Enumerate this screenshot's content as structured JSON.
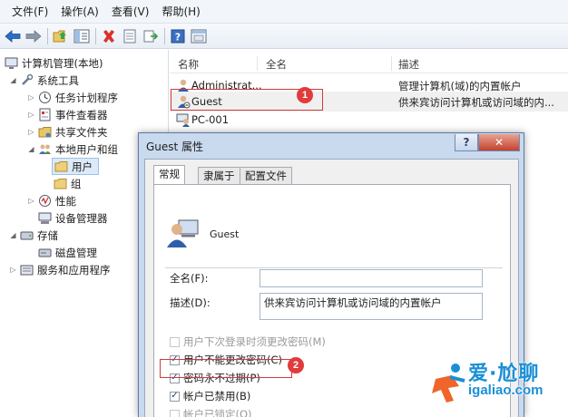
{
  "menu": [
    "文件(F)",
    "操作(A)",
    "查看(V)",
    "帮助(H)"
  ],
  "tree": {
    "root": "计算机管理(本地)",
    "system_tools": "系统工具",
    "task_scheduler": "任务计划程序",
    "event_viewer": "事件查看器",
    "shared_folders": "共享文件夹",
    "local_users": "本地用户和组",
    "users": "用户",
    "groups": "组",
    "performance": "性能",
    "device_manager": "设备管理器",
    "storage": "存储",
    "disk_mgmt": "磁盘管理",
    "services": "服务和应用程序"
  },
  "list": {
    "columns": [
      "名称",
      "全名",
      "描述"
    ],
    "rows": [
      {
        "name": "Administrat...",
        "description": "管理计算机(域)的内置帐户"
      },
      {
        "name": "Guest",
        "description": "供来宾访问计算机或访问域的内..."
      },
      {
        "name": "PC-001",
        "description": ""
      }
    ]
  },
  "badges": {
    "one": "1",
    "two": "2"
  },
  "dialog": {
    "title": "Guest 属性",
    "help_btn": "?",
    "close_btn": "✕",
    "tabs": [
      "常规",
      "隶属于",
      "配置文件"
    ],
    "user_name": "Guest",
    "fullname_label": "全名(F):",
    "fullname_value": "",
    "desc_label": "描述(D):",
    "desc_value": "供来宾访问计算机或访问域的内置帐户",
    "checkboxes": [
      {
        "label": "用户下次登录时须更改密码(M)",
        "checked": false,
        "disabled": true
      },
      {
        "label": "用户不能更改密码(C)",
        "checked": true,
        "disabled": false
      },
      {
        "label": "密码永不过期(P)",
        "checked": true,
        "disabled": false
      },
      {
        "label": "帐户已禁用(B)",
        "checked": true,
        "disabled": false
      },
      {
        "label": "帐户已锁定(O)",
        "checked": false,
        "disabled": true
      }
    ]
  },
  "watermark": {
    "line1": "爱·尬聊",
    "line2": "igaliao.com"
  },
  "colors": {
    "accent": "#1a8fd6",
    "highlight_red": "#d43a3a",
    "selection": "#dce9f8"
  }
}
